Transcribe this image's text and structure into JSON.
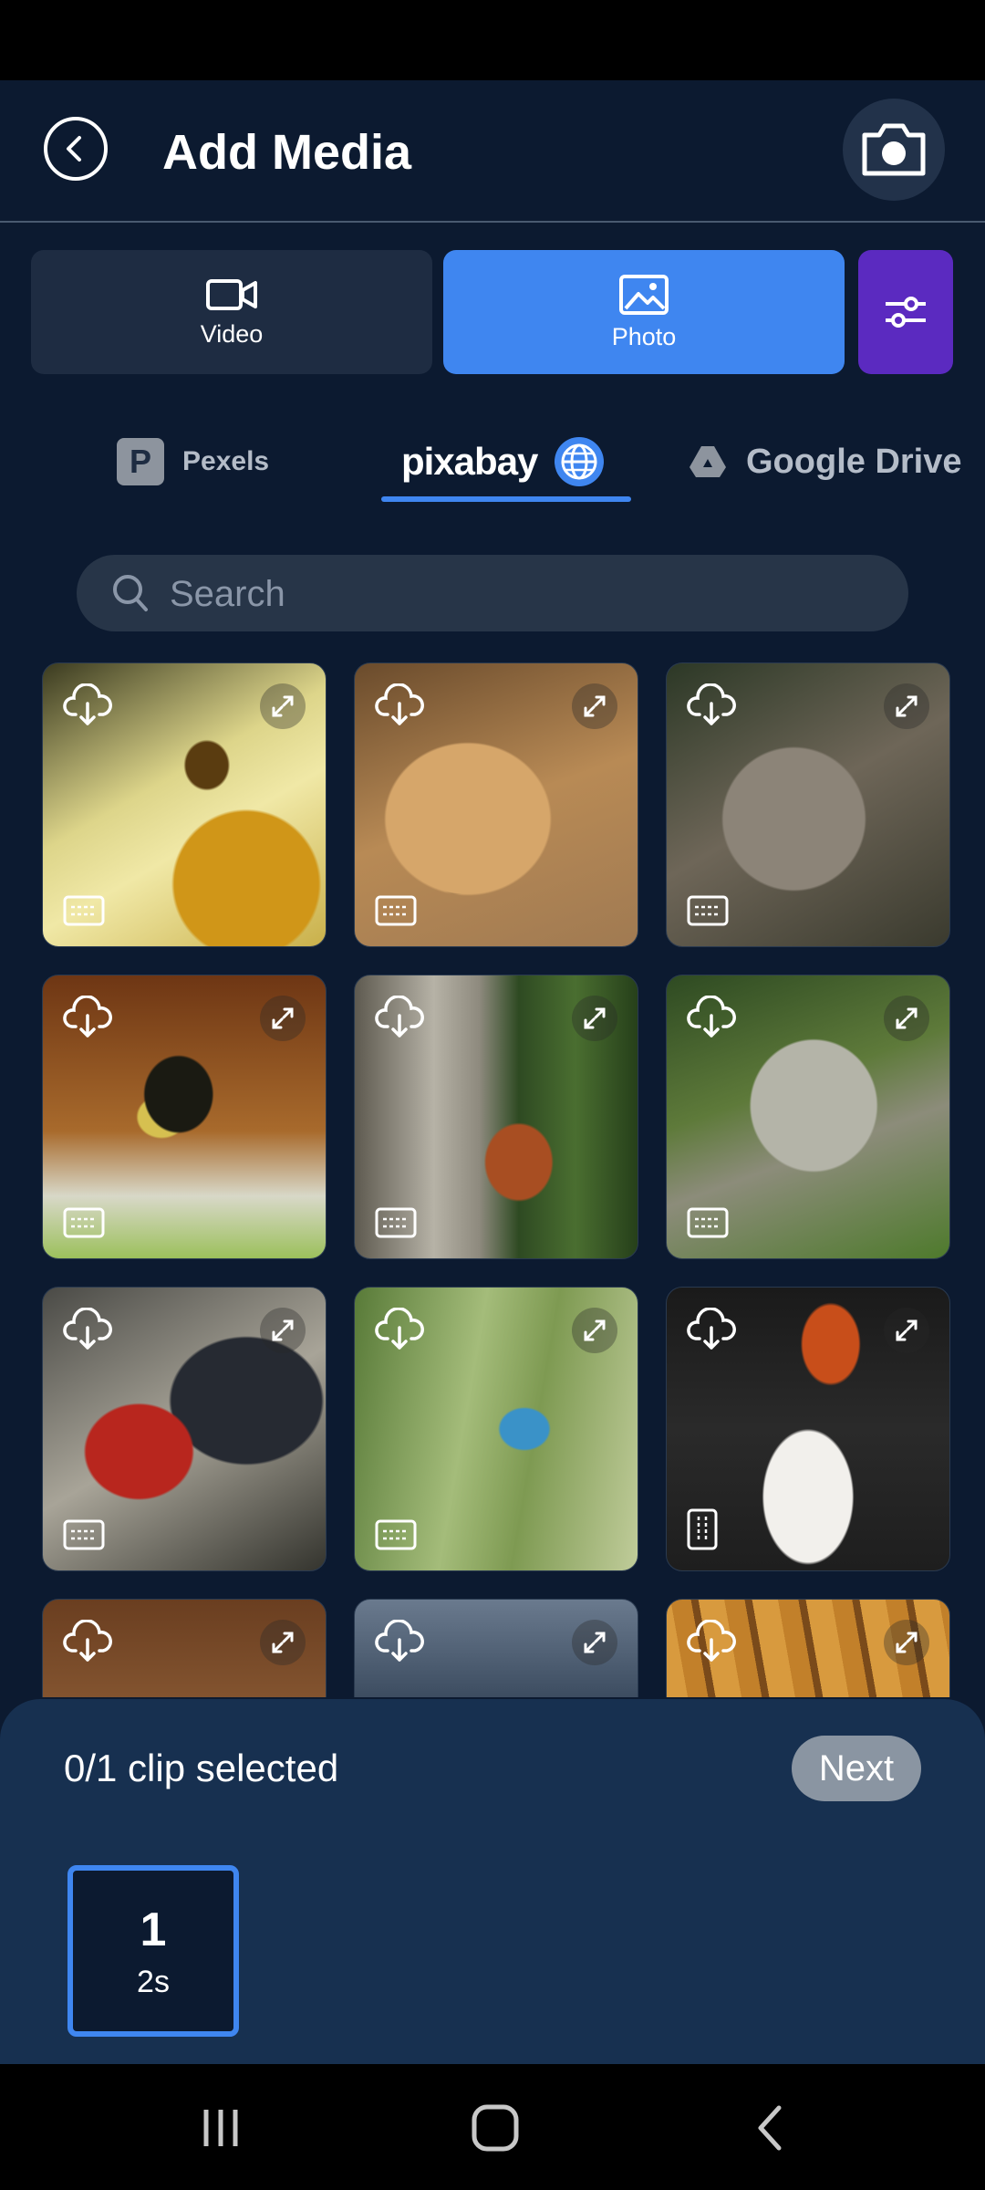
{
  "header": {
    "title": "Add Media"
  },
  "media_types": [
    {
      "label": "Video",
      "selected": false
    },
    {
      "label": "Photo",
      "selected": true
    }
  ],
  "sources": [
    {
      "label": "Pexels"
    },
    {
      "label": "pixabay",
      "selected": true
    },
    {
      "label": "Google Drive"
    }
  ],
  "search": {
    "placeholder": "Search",
    "value": ""
  },
  "grid": {
    "items": [
      {
        "subject": "bee on flower",
        "orientation": "landscape"
      },
      {
        "subject": "lioness",
        "orientation": "landscape"
      },
      {
        "subject": "wolf",
        "orientation": "landscape"
      },
      {
        "subject": "bird in flight",
        "orientation": "landscape"
      },
      {
        "subject": "squirrel on tree",
        "orientation": "landscape"
      },
      {
        "subject": "snow leopard cub",
        "orientation": "landscape"
      },
      {
        "subject": "ground hornbill",
        "orientation": "landscape"
      },
      {
        "subject": "kingfisher",
        "orientation": "landscape"
      },
      {
        "subject": "king vulture",
        "orientation": "portrait"
      },
      {
        "subject": "animal fur",
        "orientation": "landscape"
      },
      {
        "subject": "water bird",
        "orientation": "landscape"
      },
      {
        "subject": "wooden texture",
        "orientation": "landscape"
      }
    ]
  },
  "selection": {
    "status": "0/1 clip selected",
    "next_label": "Next"
  },
  "clips": [
    {
      "number": "1",
      "duration": "2s"
    }
  ],
  "colors": {
    "accent": "#3f86f0",
    "filter": "#5b2ac0",
    "background": "#0c1a30"
  }
}
